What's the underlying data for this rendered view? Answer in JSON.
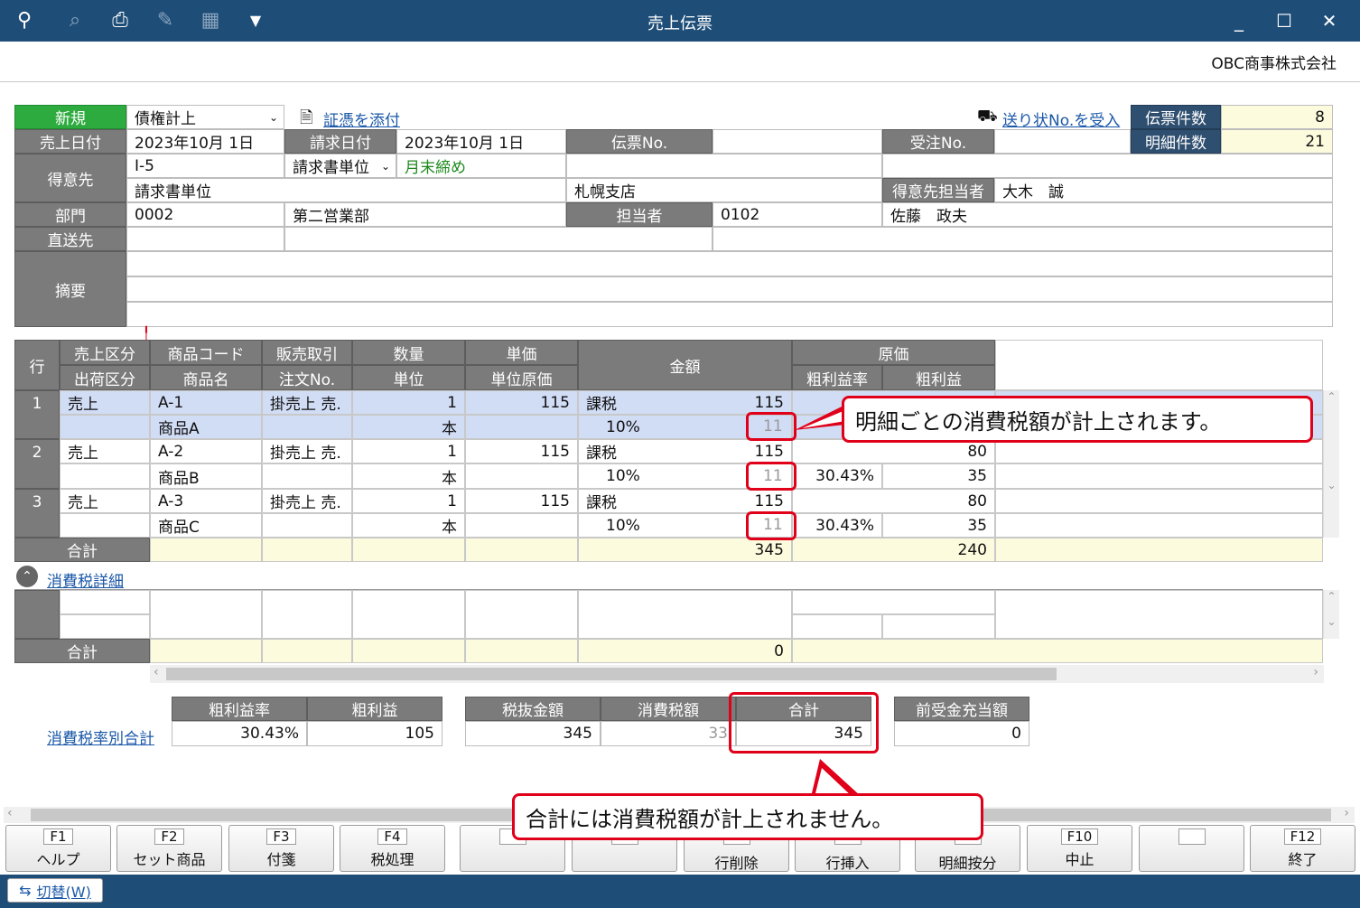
{
  "window": {
    "title": "売上伝票",
    "company": "OBC商事株式会社"
  },
  "header": {
    "new_label": "新規",
    "type_value": "債権計上",
    "attach_link": "証憑を添付",
    "receive_link": "送り状No.を受入",
    "slip_count_label": "伝票件数",
    "slip_count": "8",
    "detail_count_label": "明細件数",
    "detail_count": "21",
    "sales_date_label": "売上日付",
    "sales_date": "2023年10月  1日",
    "billing_date_label": "請求日付",
    "billing_date": "2023年10月  1日",
    "slip_no_label": "伝票No.",
    "slip_no": "",
    "order_no_label": "受注No.",
    "order_no": "",
    "customer_label": "得意先",
    "customer_code": "I-5",
    "billing_unit": "請求書単位",
    "closing": "月末締め",
    "customer_name": "請求書単位",
    "branch": "札幌支店",
    "customer_rep_label": "得意先担当者",
    "customer_rep": "大木　誠",
    "dept_label": "部門",
    "dept_code": "0002",
    "dept_name": "第二営業部",
    "staff_label": "担当者",
    "staff_code": "0102",
    "staff_name": "佐藤　政夫",
    "direct_label": "直送先",
    "summary_label": "摘要"
  },
  "grid": {
    "headers": {
      "row": "行",
      "sales_type": "売上区分",
      "ship_type": "出荷区分",
      "item_code": "商品コード",
      "item_name": "商品名",
      "sales_trade": "販売取引",
      "order_no": "注文No.",
      "qty": "数量",
      "unit": "単位",
      "price": "単価",
      "unit_cost": "単位原価",
      "amount": "金額",
      "cost": "原価",
      "margin_rate": "粗利益率",
      "margin": "粗利益"
    },
    "rows": [
      {
        "no": "1",
        "sales_type": "売上",
        "code": "A-1",
        "trade": "掛売上 売.",
        "qty": "1",
        "price": "115",
        "tax": "課税",
        "amount": "115",
        "name": "商品A",
        "unit": "本",
        "rate": "10%",
        "tax_amount": "11",
        "cost": "",
        "margin_rate": "",
        "margin": ""
      },
      {
        "no": "2",
        "sales_type": "売上",
        "code": "A-2",
        "trade": "掛売上 売.",
        "qty": "1",
        "price": "115",
        "tax": "課税",
        "amount": "115",
        "name": "商品B",
        "unit": "本",
        "rate": "10%",
        "tax_amount": "11",
        "cost": "80",
        "margin_rate": "30.43%",
        "margin": "35"
      },
      {
        "no": "3",
        "sales_type": "売上",
        "code": "A-3",
        "trade": "掛売上 売.",
        "qty": "1",
        "price": "115",
        "tax": "課税",
        "amount": "115",
        "name": "商品C",
        "unit": "本",
        "rate": "10%",
        "tax_amount": "11",
        "cost": "80",
        "margin_rate": "30.43%",
        "margin": "35"
      }
    ],
    "total_label": "合計",
    "total_amount": "345",
    "total_margin": "240"
  },
  "tax_detail": {
    "link": "消費税詳細",
    "total_label": "合計",
    "total_amount": "0"
  },
  "summary": {
    "link": "消費税率別合計",
    "margin_rate_label": "粗利益率",
    "margin_rate": "30.43%",
    "margin_label": "粗利益",
    "margin": "105",
    "pretax_label": "税抜金額",
    "pretax": "345",
    "tax_label": "消費税額",
    "tax": "33",
    "total_label": "合計",
    "total": "345",
    "advance_label": "前受金充当額",
    "advance": "0"
  },
  "callouts": {
    "detail_tax": "明細ごとの消費税額が計上されます。",
    "total_note": "合計には消費税額が計上されません。"
  },
  "fkeys": [
    {
      "key": "F1",
      "label": "ヘルプ"
    },
    {
      "key": "F2",
      "label": "セット商品"
    },
    {
      "key": "F3",
      "label": "付箋"
    },
    {
      "key": "F4",
      "label": "税処理"
    },
    {
      "key": "",
      "label": ""
    },
    {
      "key": "",
      "label": ""
    },
    {
      "key": "",
      "label": "行削除"
    },
    {
      "key": "",
      "label": "行挿入"
    },
    {
      "key": "",
      "label": "明細按分"
    },
    {
      "key": "F10",
      "label": "中止"
    },
    {
      "key": "",
      "label": ""
    },
    {
      "key": "F12",
      "label": "終了"
    }
  ],
  "switch_label": "切替(W)"
}
